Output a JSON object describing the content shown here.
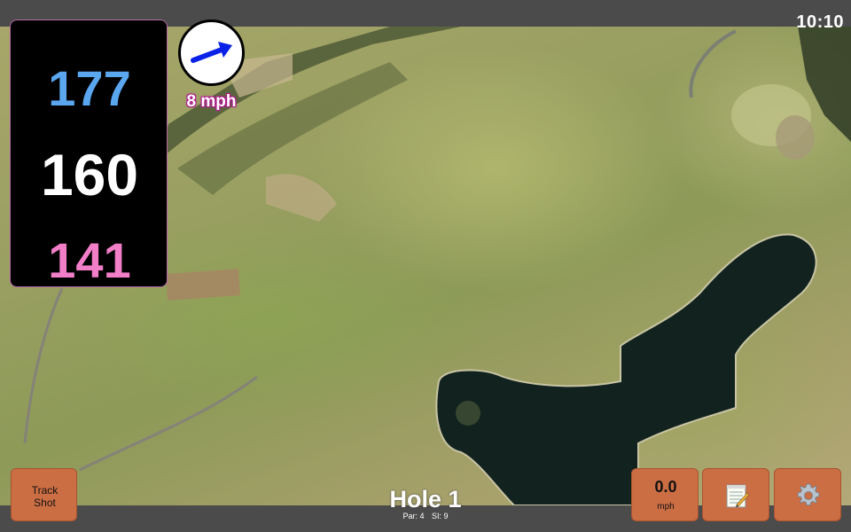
{
  "status": {
    "time": "10:10"
  },
  "distances": {
    "back": "177",
    "middle": "160",
    "front": "141"
  },
  "distance_colors": {
    "back": "#5aa7f0",
    "middle": "#ffffff",
    "front": "#f27ec8"
  },
  "wind": {
    "speed_label": "8 mph",
    "arrow_icon": "wind-direction-arrow-icon",
    "arrow_color": "#0a22e8"
  },
  "hole": {
    "title": "Hole 1",
    "par_label": "Par: 4",
    "si_label": "SI: 9"
  },
  "buttons": {
    "track_shot_line1": "Track",
    "track_shot_line2": "Shot",
    "speed_value": "0.0",
    "speed_unit": "mph",
    "notes_icon": "notepad-icon",
    "settings_icon": "gear-icon"
  },
  "colors": {
    "button": "#cc6e44",
    "bar": "#4b4b4b",
    "panel_border": "#b768a8"
  }
}
